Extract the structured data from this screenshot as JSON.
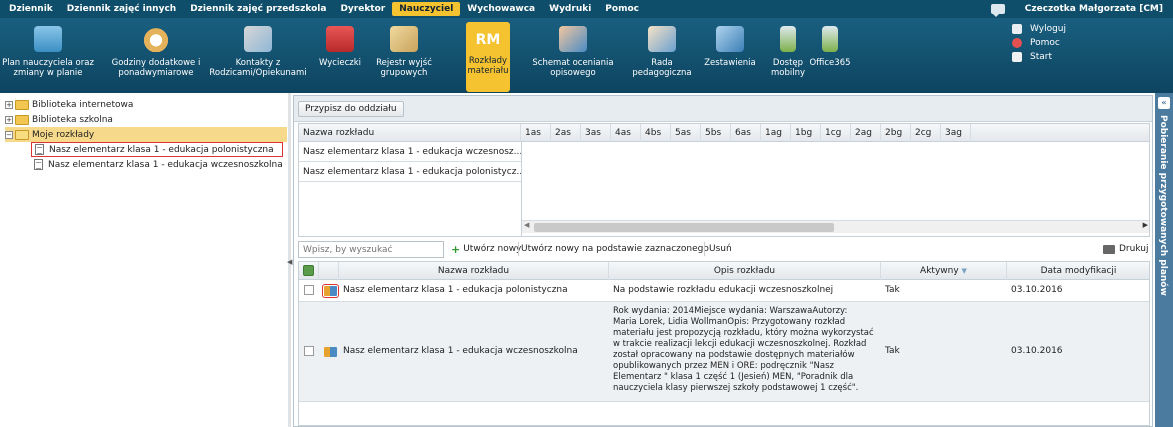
{
  "top_menu": {
    "items": [
      "Dziennik",
      "Dziennik zajęć innych",
      "Dziennik zajęć przedszkola",
      "Dyrektor",
      "Nauczyciel",
      "Wychowawca",
      "Wydruki",
      "Pomoc"
    ],
    "active": "Nauczyciel",
    "user": "Czeczotka Małgorzata [CM]"
  },
  "toolbar": {
    "items": [
      {
        "line1": "Plan nauczyciela oraz",
        "line2": "zmiany w planie"
      },
      {
        "line1": "Godziny dodatkowe i",
        "line2": "ponadwymiarowe"
      },
      {
        "line1": "Kontakty z",
        "line2": "Rodzicami/Opiekunami"
      },
      {
        "line1": "Wycieczki",
        "line2": ""
      },
      {
        "line1": "Rejestr wyjść",
        "line2": "grupowych"
      },
      {
        "line1": "Rozkłady",
        "line2": "materiału",
        "badge": "RM"
      },
      {
        "line1": "Schemat oceniania",
        "line2": "opisowego"
      },
      {
        "line1": "Rada",
        "line2": "pedagogiczna"
      },
      {
        "line1": "Zestawienia",
        "line2": ""
      },
      {
        "line1": "Dostęp",
        "line2": "mobilny"
      },
      {
        "line1": "Office365",
        "line2": ""
      }
    ],
    "user_actions": [
      "Wyloguj",
      "Pomoc",
      "Start"
    ]
  },
  "tree": {
    "nodes": [
      "Biblioteka internetowa",
      "Biblioteka szkolna",
      "Moje rozkłady",
      "Nasz elementarz klasa 1 - edukacja polonistyczna",
      "Nasz elementarz klasa 1 - edukacja wczesnoszkolna"
    ],
    "expander_collapsed": "+",
    "expander_expanded": "−"
  },
  "splitter_arrow": "◀",
  "side_panel": {
    "label": "Pobieranie przygotowanych planów",
    "collapse": "«"
  },
  "assign_button": "Przypisz do oddziału",
  "assign_grid": {
    "name_header": "Nazwa rozkładu",
    "class_headers": [
      "1as",
      "2as",
      "3as",
      "4as",
      "4bs",
      "5as",
      "5bs",
      "6as",
      "1ag",
      "1bg",
      "1cg",
      "2ag",
      "2bg",
      "2cg",
      "3ag"
    ],
    "rows": [
      "Nasz elementarz klasa 1 - edukacja wczesnosz...",
      "Nasz elementarz klasa 1 - edukacja polonistycz..."
    ],
    "scroll_left": "◀",
    "scroll_right": "▶"
  },
  "toolbar2": {
    "search_placeholder": "Wpisz, by wyszukać",
    "new_button": "Utwórz nowy",
    "new_from_selected_button": "Utwórz nowy na podstawie zaznaczonego",
    "delete_button": "Usuń",
    "print_button": "Drukuj",
    "plus_icon": "+"
  },
  "main_grid": {
    "headers": {
      "name": "Nazwa rozkładu",
      "description": "Opis rozkładu",
      "active": "Aktywny",
      "active_sort": "▼",
      "modified": "Data modyfikacji"
    },
    "rows": [
      {
        "name": "Nasz elementarz klasa 1 - edukacja polonistyczna",
        "description": "Na podstawie rozkładu edukacji wczesnoszkolnej",
        "active": "Tak",
        "modified": "03.10.2016"
      },
      {
        "name": "Nasz elementarz klasa 1 - edukacja wczesnoszkolna",
        "description_lines": [
          "Rok wydania: 2014Miejsce wydania: WarszawaAutorzy:",
          "Maria Lorek, Lidia WollmanOpis: Przygotowany rozkład",
          "materiału jest propozycją rozkładu, który można wykorzystać",
          "w trakcie realizacji lekcji edukacji wczesnoszkolnej. Rozkład",
          "został opracowany na podstawie dostępnych materiałów",
          "opublikowanych przez MEN i ORE: podręcznik \"Nasz",
          "Elementarz \" klasa 1 część 1 (Jesień) MEN, \"Poradnik dla",
          "nauczyciela klasy pierwszej szkoły podstawowej 1 część\"."
        ],
        "active": "Tak",
        "modified": "03.10.2016"
      }
    ]
  }
}
